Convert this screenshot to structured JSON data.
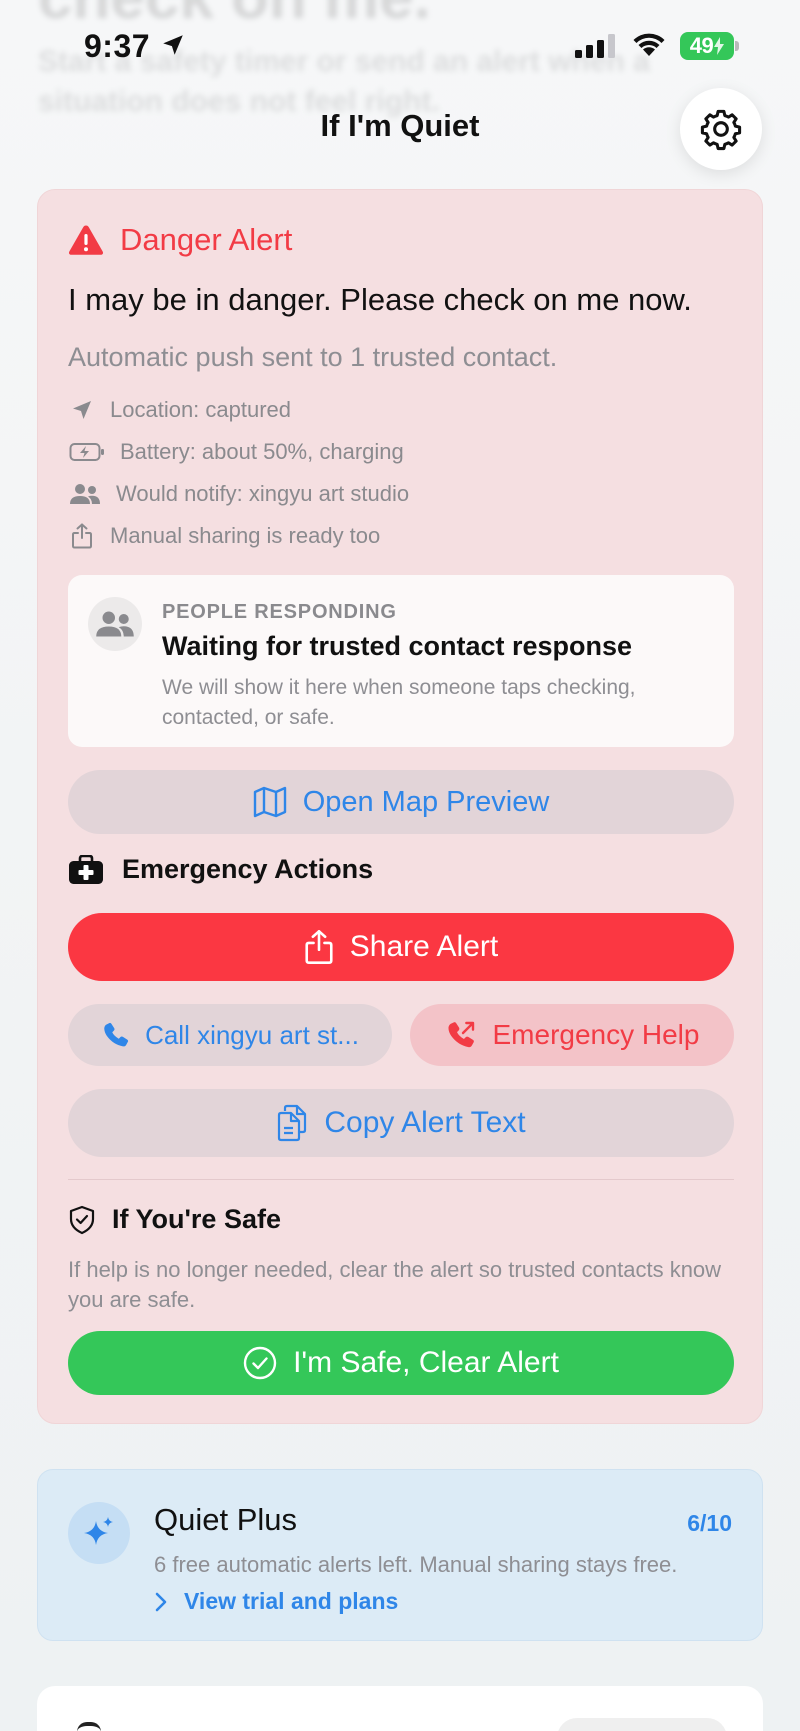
{
  "background_ghost": {
    "title": "check on me.",
    "subtitle": "Start a safety timer or send an alert when a situation does not feel right."
  },
  "status_bar": {
    "time": "9:37",
    "battery_percent": "49"
  },
  "header": {
    "title": "If I'm Quiet"
  },
  "danger_alert": {
    "heading": "Danger Alert",
    "message": "I may be in danger. Please check on me now.",
    "push_status": "Automatic push sent to 1 trusted contact.",
    "details": [
      {
        "icon": "location-arrow-icon",
        "text": "Location: captured"
      },
      {
        "icon": "battery-charging-icon",
        "text": "Battery: about 50%, charging"
      },
      {
        "icon": "people-icon",
        "text": "Would notify: xingyu art studio"
      },
      {
        "icon": "share-icon",
        "text": "Manual sharing is ready too"
      }
    ],
    "responding": {
      "label": "PEOPLE RESPONDING",
      "title": "Waiting for trusted contact response",
      "description": "We will show it here when someone taps checking, contacted, or safe."
    },
    "map_button": "Open Map Preview",
    "actions_heading": "Emergency Actions",
    "share_button": "Share Alert",
    "call_button": "Call xingyu art st...",
    "emergency_button": "Emergency Help",
    "copy_button": "Copy Alert Text",
    "safe_heading": "If You're Safe",
    "safe_description": "If help is no longer needed, clear the alert so trusted contacts know you are safe.",
    "safe_button": "I'm Safe, Clear Alert"
  },
  "quiet_plus": {
    "title": "Quiet Plus",
    "count": "6/10",
    "description": "6 free automatic alerts left. Manual sharing stays free.",
    "link": "View trial and plans"
  },
  "colors": {
    "danger_red": "#fb3742",
    "link_blue": "#2f86e8",
    "safe_green": "#34c759",
    "card_pink": "#f5dfe1",
    "plus_blue": "#dcebf6"
  }
}
